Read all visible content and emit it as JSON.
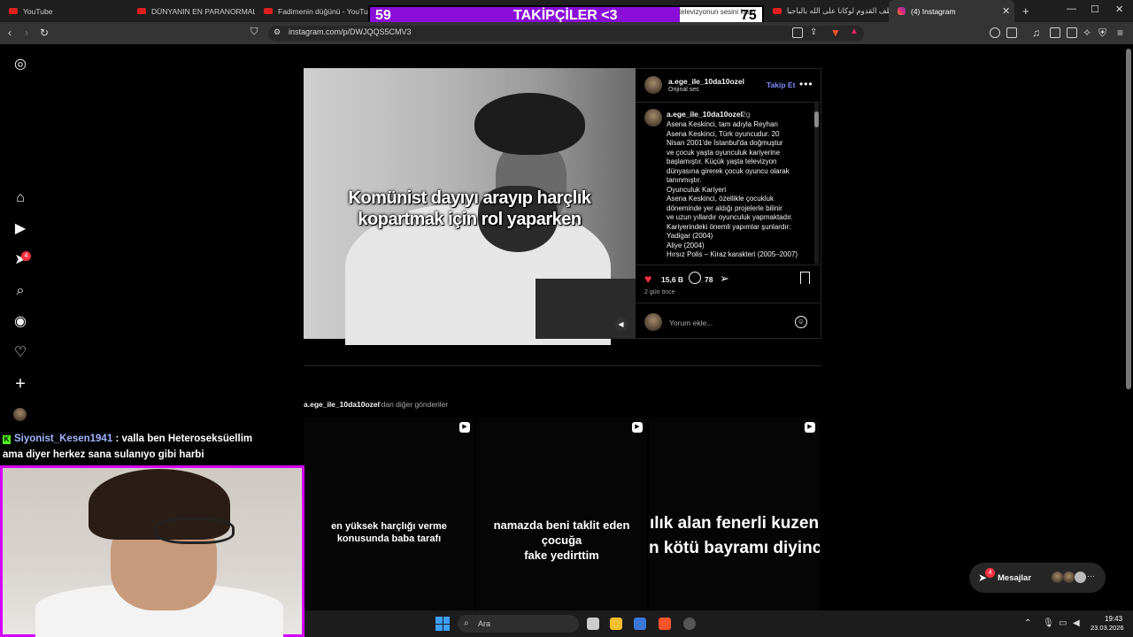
{
  "browser": {
    "tabs": [
      {
        "label": "YouTube"
      },
      {
        "label": "DÜNYANIN EN PARANORMAL OR"
      },
      {
        "label": "Fadimenin düğünü - YouTube"
      },
      {
        "label": "televizyonun sesini kısm"
      },
      {
        "label": "لطف القدوم لوكانا على الله بالباجيا"
      },
      {
        "label": "(4) Instagram"
      }
    ],
    "url": "instagram.com/p/DWJQQS5CMV3"
  },
  "overlay": {
    "followers_current": "59",
    "followers_title": "TAKİPÇİLER <3",
    "followers_goal": "75",
    "progress": 0.79
  },
  "sidebar": {
    "notif_count": "4"
  },
  "post": {
    "video_caption_1": "Komünist dayıyı arayıp harçlık",
    "video_caption_2": "kopartmak için rol yaparken",
    "author": "a.ege_ile_10da10ozel",
    "audio": "Orijinal ses",
    "follow_label": "Takip Et",
    "comment_author": "a.ege_ile_10da10ozel",
    "comment_time": "2g",
    "comment_lines": [
      "Asena Keskinci, tam adıyla Reyhan",
      "Asena Keskinci, Türk oyuncudur. 20",
      "Nisan 2001'de İstanbul'da doğmuştur",
      "ve çocuk yaşta oyunculuk kariyerine",
      "başlamıştır. Küçük yaşta televizyon",
      "dünyasına girerek çocuk oyuncu olarak",
      "tanınmıştır.",
      "Oyunculuk Kariyeri",
      "Asena Keskinci, özellikle çocukluk",
      "döneminde yer aldığı projelerle bilinir",
      "ve uzun yıllardır oyunculuk yapmaktadır.",
      "Kariyerindeki önemli yapımlar şunlardır:",
      "Yadigar (2004)",
      "Aliye (2004)",
      "Hırsız Polis – Kiraz karakteri (2005–2007)"
    ],
    "likes": "15,6 B",
    "comments": "78",
    "posted": "2 gün önce",
    "comment_placeholder": "Yorum ekle..."
  },
  "more_posts": {
    "user": "a.ege_ile_10da10ozel",
    "suffix": "'dan diğer gönderiler",
    "thumbs": [
      {
        "line1": "en yüksek harçlığı verme",
        "line2": "konusunda baba tarafı"
      },
      {
        "line1": "namazda beni taklit eden çocuğa",
        "line2": "fake yedirttim"
      },
      {
        "line1": "ılık alan fenerli kuzen",
        "line2": "n kötü bayramı diyinc"
      }
    ]
  },
  "messages": {
    "label": "Mesajlar",
    "badge": "4"
  },
  "chat": {
    "user": "Siyonist_Kesen1941",
    "text1": ": valla ben Heteroseksüellim",
    "text2": "ama diyer herkez sana sulanıyo gibi harbi"
  },
  "taskbar": {
    "search_placeholder": "Ara",
    "time": "19:43",
    "date": "23.03.2026"
  }
}
